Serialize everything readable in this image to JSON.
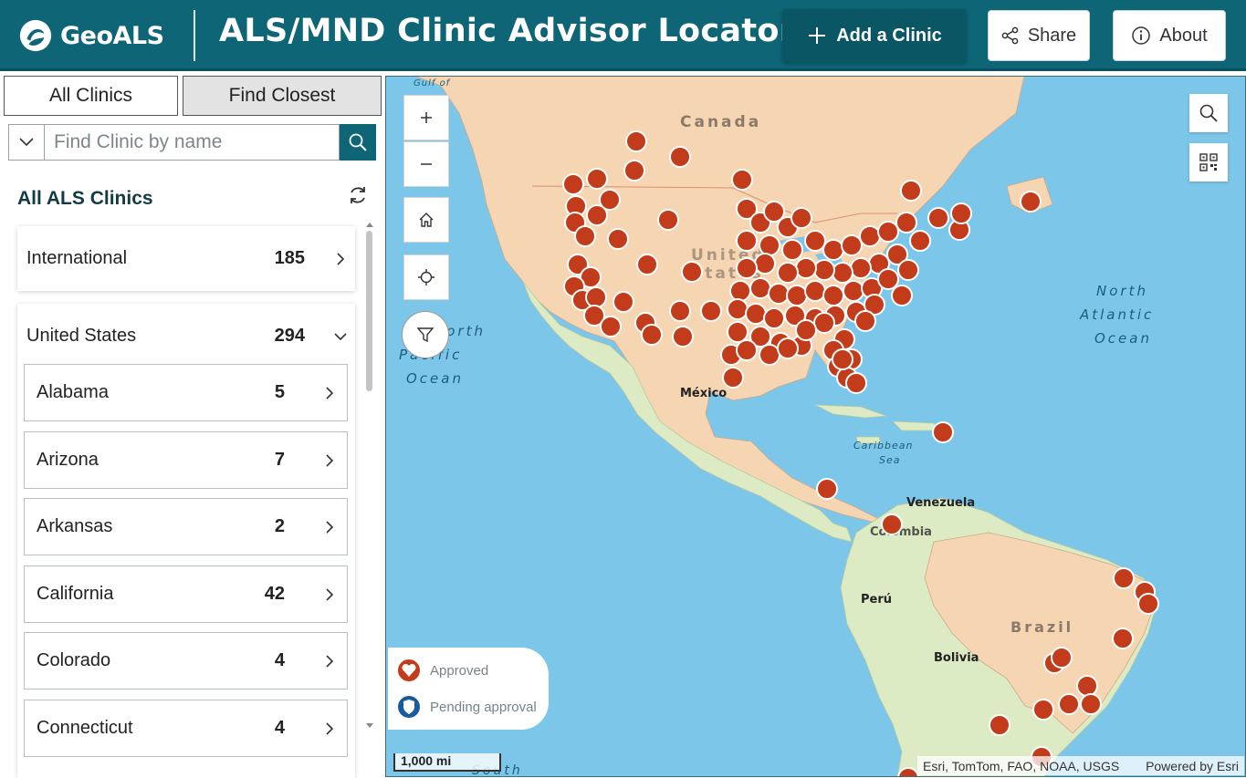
{
  "header": {
    "logo_text": "GeoALS",
    "title": "ALS/MND Clinic Advisor Locator",
    "add_label": "Add a Clinic",
    "share_label": "Share",
    "about_label": "About"
  },
  "tabs": {
    "all": "All Clinics",
    "closest": "Find Closest"
  },
  "search": {
    "placeholder": "Find Clinic by name"
  },
  "list": {
    "title": "All ALS Clinics",
    "groups": [
      {
        "label": "International",
        "count": "185"
      },
      {
        "label": "United States",
        "count": "294"
      }
    ],
    "states": [
      {
        "label": "Alabama",
        "count": "5"
      },
      {
        "label": "Arizona",
        "count": "7"
      },
      {
        "label": "Arkansas",
        "count": "2"
      },
      {
        "label": "California",
        "count": "42"
      },
      {
        "label": "Colorado",
        "count": "4"
      },
      {
        "label": "Connecticut",
        "count": "4"
      }
    ]
  },
  "map": {
    "labels": {
      "canada": "Canada",
      "united_states": "United States",
      "mexico": "México",
      "north_atlantic_1": "North",
      "north_atlantic_2": "Atlantic",
      "north_atlantic_3": "Ocean",
      "north_pacific_1": "North",
      "north_pacific_2": "Pacific",
      "north_pacific_3": "Ocean",
      "caribbean_1": "Caribbean",
      "caribbean_2": "Sea",
      "gulf": "Gulf of",
      "venezuela": "Venezuela",
      "colombia": "Colombia",
      "peru": "Perú",
      "brazil": "Brazil",
      "bolivia": "Bolivia",
      "south": "South"
    },
    "legend": {
      "approved": "Approved",
      "pending": "Pending approval"
    },
    "scale": "1,000 mi",
    "attribution": "Esri, TomTom, FAO, NOAA, USGS",
    "powered_by": "Powered by Esri"
  },
  "colors": {
    "header": "#0d6576",
    "marker_approved": "#c23b1a",
    "marker_pending": "#1b5a9c",
    "ocean": "#7cc6ea",
    "land_us": "#f6d5b3",
    "land_latin": "#dcebc3"
  }
}
